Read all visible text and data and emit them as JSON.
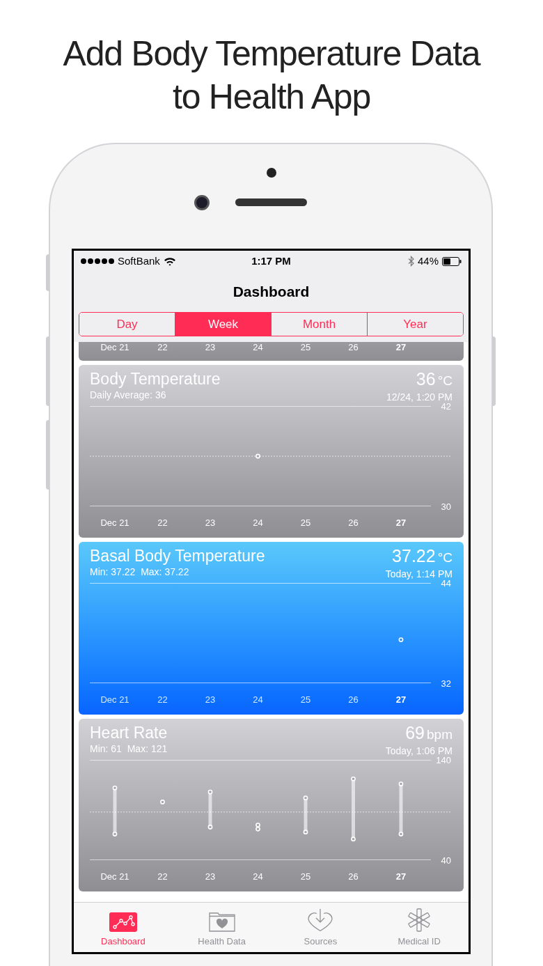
{
  "headline": [
    "Add Body Temperature Data",
    "to Health App"
  ],
  "status_bar": {
    "carrier": "SoftBank",
    "time": "1:17 PM",
    "battery": "44%"
  },
  "nav": {
    "title": "Dashboard"
  },
  "segments": [
    {
      "label": "Day",
      "selected": false
    },
    {
      "label": "Week",
      "selected": true
    },
    {
      "label": "Month",
      "selected": false
    },
    {
      "label": "Year",
      "selected": false
    }
  ],
  "partial_card": {
    "x_labels": [
      "Dec 21",
      "22",
      "23",
      "24",
      "25",
      "26",
      "27"
    ]
  },
  "cards": [
    {
      "title": "Body Temperature",
      "subtitle": "Daily Average: 36",
      "value": "36",
      "unit": "°C",
      "time": "12/24, 1:20 PM",
      "selected": false,
      "chart_data": {
        "type": "scatter",
        "categories": [
          "Dec 21",
          "22",
          "23",
          "24",
          "25",
          "26",
          "27"
        ],
        "series": [
          {
            "values": [
              null,
              null,
              null,
              36,
              null,
              null,
              null
            ]
          }
        ],
        "ylim": [
          30,
          42
        ],
        "yticks": [
          42,
          30
        ],
        "ref_lines": [
          {
            "axis": "y",
            "value": 36
          }
        ]
      }
    },
    {
      "title": "Basal Body Temperature",
      "subtitle": "Min: 37.22  Max: 37.22",
      "value": "37.22",
      "unit": "°C",
      "time": "Today, 1:14 PM",
      "selected": true,
      "chart_data": {
        "type": "scatter",
        "categories": [
          "Dec 21",
          "22",
          "23",
          "24",
          "25",
          "26",
          "27"
        ],
        "series": [
          {
            "values": [
              null,
              null,
              null,
              null,
              null,
              null,
              37.2
            ]
          }
        ],
        "ylim": [
          32,
          44
        ],
        "yticks": [
          44,
          32
        ]
      }
    },
    {
      "title": "Heart Rate",
      "subtitle": "Min: 61  Max: 121",
      "value": "69",
      "unit": "bpm",
      "time": "Today, 1:06 PM",
      "selected": false,
      "chart_data": {
        "type": "scatter",
        "categories": [
          "Dec 21",
          "22",
          "23",
          "24",
          "25",
          "26",
          "27"
        ],
        "series": [
          {
            "values": [
              112,
              98,
              108,
              75,
              102,
              121,
              116
            ]
          },
          {
            "values": [
              66,
              null,
              73,
              71,
              68,
              61,
              66
            ]
          }
        ],
        "ylim": [
          40,
          140
        ],
        "yticks": [
          140,
          40
        ],
        "ref_lines": [
          {
            "axis": "y",
            "value": 88
          }
        ]
      }
    }
  ],
  "tabs": [
    {
      "label": "Dashboard",
      "kind": "dashboard",
      "selected": true
    },
    {
      "label": "Health Data",
      "kind": "health_data",
      "selected": false
    },
    {
      "label": "Sources",
      "kind": "sources",
      "selected": false
    },
    {
      "label": "Medical ID",
      "kind": "medical_id",
      "selected": false
    }
  ]
}
